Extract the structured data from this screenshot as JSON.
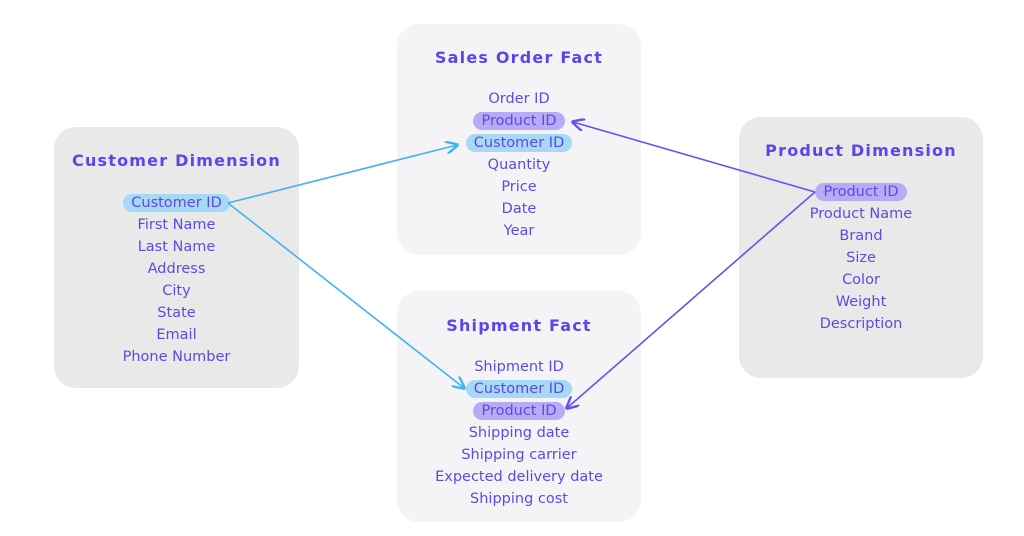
{
  "colors": {
    "primary_text": "#5b4be4",
    "customer_key_highlight": "#a7d8f5",
    "product_key_highlight": "#b7abf5",
    "customer_arrow": "#3fb4f2",
    "product_arrow": "#6a4ff0"
  },
  "customer": {
    "title": "Customer Dimension",
    "items": [
      "Customer ID",
      "First Name",
      "Last Name",
      "Address",
      "City",
      "State",
      "Email",
      "Phone Number"
    ]
  },
  "sales": {
    "title": "Sales Order Fact",
    "items": [
      "Order ID",
      "Product ID",
      "Customer ID",
      "Quantity",
      "Price",
      "Date",
      "Year"
    ]
  },
  "shipment": {
    "title": "Shipment Fact",
    "items": [
      "Shipment ID",
      "Customer ID",
      "Product ID",
      "Shipping date",
      "Shipping carrier",
      "Expected delivery date",
      "Shipping cost"
    ]
  },
  "product": {
    "title": "Product Dimension",
    "items": [
      "Product ID",
      "Product Name",
      "Brand",
      "Size",
      "Color",
      "Weight",
      "Description"
    ]
  },
  "relationships": [
    {
      "from": "Customer Dimension.Customer ID",
      "to": "Sales Order Fact.Customer ID"
    },
    {
      "from": "Customer Dimension.Customer ID",
      "to": "Shipment Fact.Customer ID"
    },
    {
      "from": "Product Dimension.Product ID",
      "to": "Sales Order Fact.Product ID"
    },
    {
      "from": "Product Dimension.Product ID",
      "to": "Shipment Fact.Product ID"
    }
  ]
}
